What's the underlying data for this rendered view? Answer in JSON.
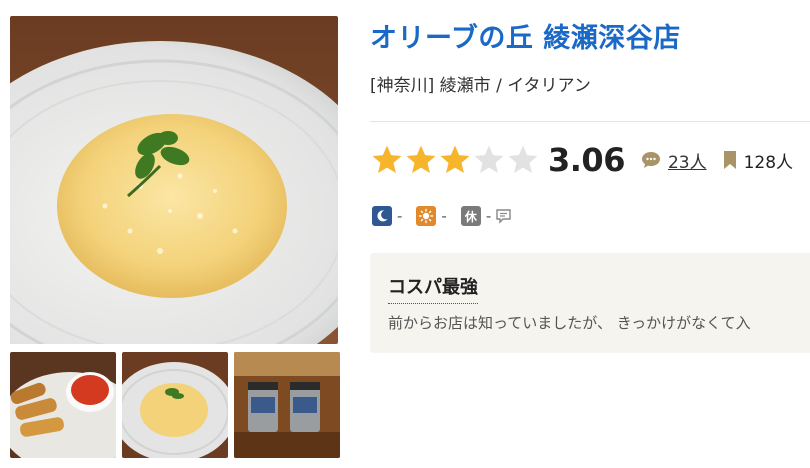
{
  "restaurant": {
    "name": "オリーブの丘 綾瀬深谷店",
    "area": "[神奈川] 綾瀬市 / イタリアン"
  },
  "rating": {
    "stars_filled": 3,
    "stars_total": 5,
    "score": "3.06",
    "reviews_label": "23人",
    "saves_label": "128人",
    "star_color": "#f7b52c",
    "star_empty_color": "#e2e2e2"
  },
  "hours": {
    "night_value": "-",
    "day_value": "-",
    "holiday_icon_text": "休",
    "holiday_value": "-"
  },
  "review": {
    "title": "コスパ最強",
    "excerpt": "前からお店は知っていましたが、 きっかけがなくて入"
  },
  "icons": {
    "review_count": "speech-bubble-icon",
    "save_count": "bookmark-icon",
    "night": "moon-icon",
    "day": "sun-icon",
    "holiday_comment": "comment-icon"
  },
  "colors": {
    "title": "#1a69c6",
    "review_bg": "#f5f4ef"
  }
}
